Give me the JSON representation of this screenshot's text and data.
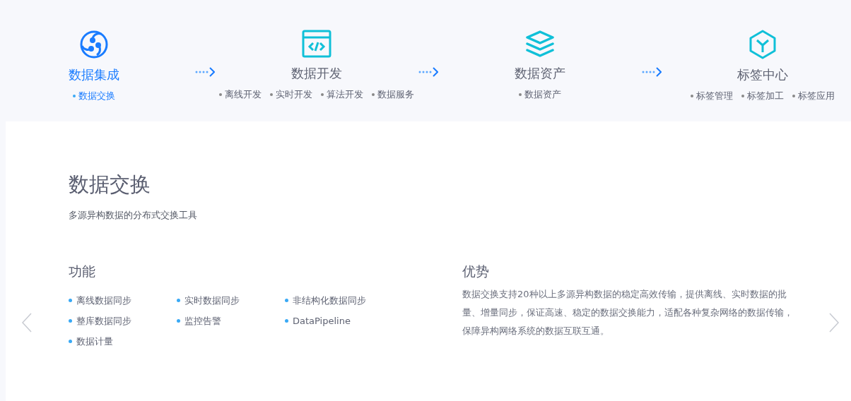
{
  "stages": [
    {
      "kind": "integration",
      "title": "数据集成",
      "selected": true,
      "items": [
        {
          "label": "数据交换",
          "selected": true
        }
      ]
    },
    {
      "kind": "development",
      "title": "数据开发",
      "selected": false,
      "items": [
        {
          "label": "离线开发",
          "selected": false
        },
        {
          "label": "实时开发",
          "selected": false
        },
        {
          "label": "算法开发",
          "selected": false
        },
        {
          "label": "数据服务",
          "selected": false
        }
      ]
    },
    {
      "kind": "assets",
      "title": "数据资产",
      "selected": false,
      "items": [
        {
          "label": "数据资产",
          "selected": false
        }
      ]
    },
    {
      "kind": "tags",
      "title": "标签中心",
      "selected": false,
      "items": [
        {
          "label": "标签管理",
          "selected": false
        },
        {
          "label": "标签加工",
          "selected": false
        },
        {
          "label": "标签应用",
          "selected": false
        }
      ]
    }
  ],
  "detail": {
    "title": "数据交换",
    "subtitle": "多源异构数据的分布式交换工具",
    "features": {
      "heading": "功能",
      "items": [
        "离线数据同步",
        "实时数据同步",
        "非结构化数据同步",
        "整库数据同步",
        "监控告警",
        "DataPipeline",
        "数据计量"
      ]
    },
    "advantages": {
      "heading": "优势",
      "text": "数据交换支持20种以上多源异构数据的稳定高效传输，提供离线、实时数据的批量、增量同步，保证高速、稳定的数据交换能力，适配各种复杂网络的数据传输，保障异构网络系统的数据互联互通。"
    }
  }
}
